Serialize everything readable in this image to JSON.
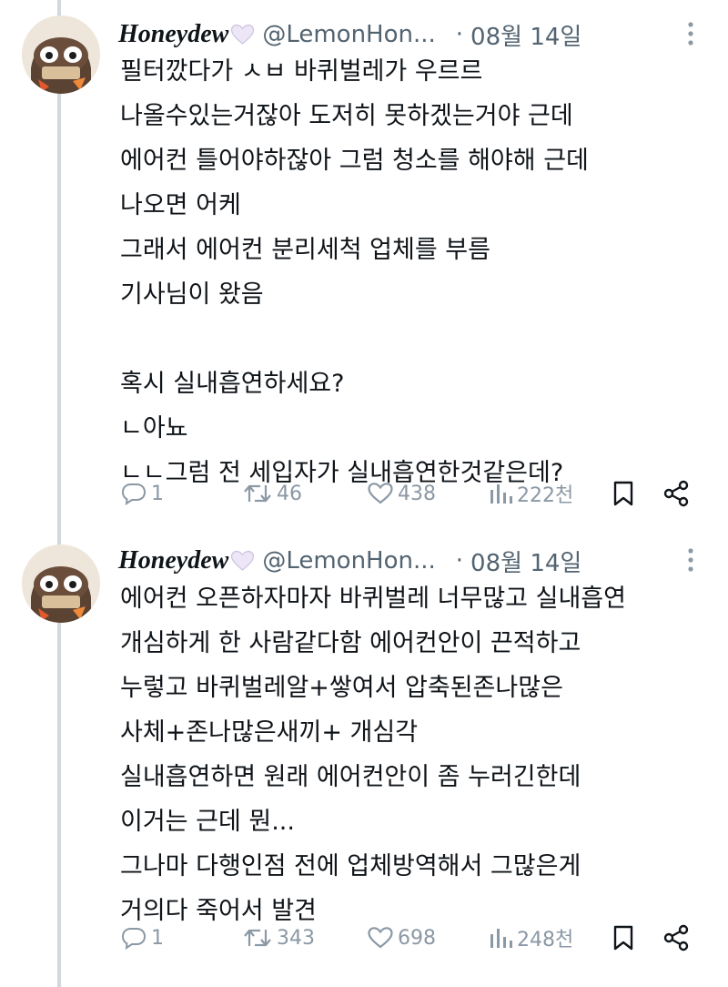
{
  "tweets": [
    {
      "display_name": "Honeydew",
      "handle": "@LemonHon...",
      "date": "08월 14일",
      "lines": [
        "필터깠다가 ㅅㅂ 바퀴벌레가 우르르",
        "나올수있는거잖아 도저히 못하겠는거야 근데",
        "에어컨 틀어야하잖아 그럼 청소를 해야해 근데",
        "나오면 어케",
        "그래서 에어컨 분리세척 업체를 부름",
        "기사님이 왔음",
        "",
        "혹시 실내흡연하세요?",
        "ㄴ아뇨",
        "ㄴㄴ그럼 전 세입자가 실내흡연한것같은데?"
      ],
      "replies": "1",
      "retweets": "46",
      "likes": "438",
      "views": "222천"
    },
    {
      "display_name": "Honeydew",
      "handle": "@LemonHon...",
      "date": "08월 14일",
      "lines": [
        "에어컨 오픈하자마자 바퀴벌레 너무많고 실내흡연",
        "개심하게 한 사람같다함 에어컨안이 끈적하고",
        "누렇고 바퀴벌레알+쌓여서 압축된존나많은",
        "사체+존나많은새끼+ 개심각",
        "실내흡연하면 원래 에어컨안이 좀 누러긴한데",
        "이거는 근데 뭔...",
        "그나마 다행인점 전에 업체방역해서 그많은게",
        "거의다 죽어서 발견"
      ],
      "replies": "1",
      "retweets": "343",
      "likes": "698",
      "views": "248천"
    }
  ],
  "colors": {
    "text": "#0f1419",
    "secondary": "#536471",
    "action": "#8b98a5",
    "thread_line": "#cfd9de",
    "heart": "#ece6f6"
  },
  "icons": [
    "reply-icon",
    "retweet-icon",
    "like-icon",
    "views-icon",
    "bookmark-icon",
    "share-icon",
    "more-icon",
    "white-heart-icon"
  ]
}
